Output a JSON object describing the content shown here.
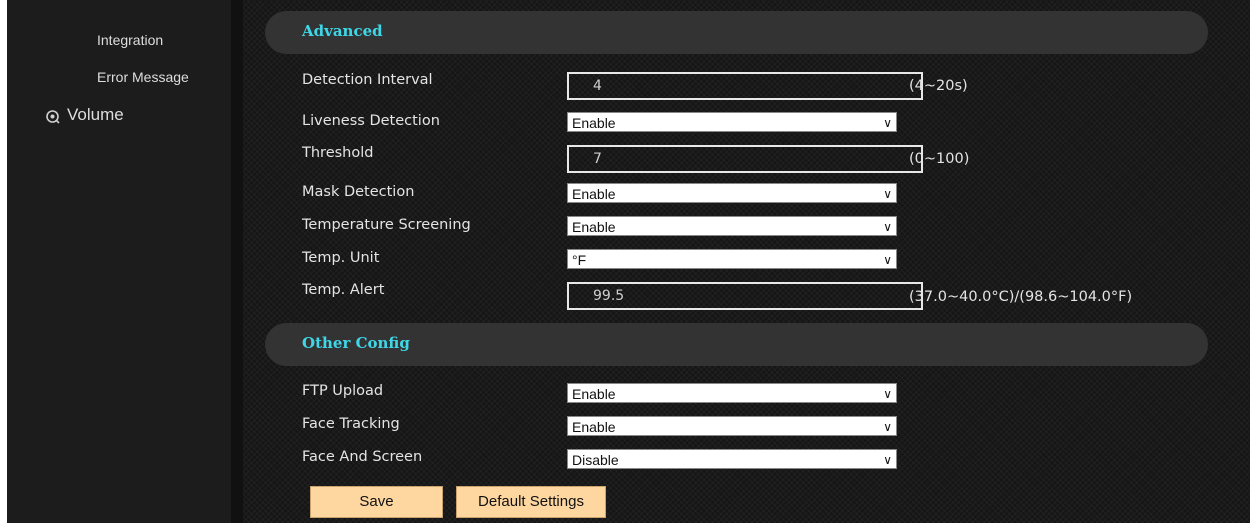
{
  "sidebar": {
    "items": [
      {
        "label": "Integration"
      },
      {
        "label": "Error Message"
      },
      {
        "label": "Volume"
      }
    ]
  },
  "advanced": {
    "title": "Advanced",
    "detection_interval": {
      "label": "Detection Interval",
      "value": "4",
      "hint": "(4~20s)"
    },
    "liveness_detection": {
      "label": "Liveness Detection",
      "value": "Enable"
    },
    "threshold": {
      "label": "Threshold",
      "value": "7",
      "hint": "(0~100)"
    },
    "mask_detection": {
      "label": "Mask Detection",
      "value": "Enable"
    },
    "temperature_screening": {
      "label": "Temperature Screening",
      "value": "Enable"
    },
    "temp_unit": {
      "label": "Temp. Unit",
      "value": "°F"
    },
    "temp_alert": {
      "label": "Temp. Alert",
      "value": "99.5",
      "hint": "(37.0~40.0°C)/(98.6~104.0°F)"
    }
  },
  "other_config": {
    "title": "Other Config",
    "ftp_upload": {
      "label": "FTP Upload",
      "value": "Enable"
    },
    "face_tracking": {
      "label": "Face Tracking",
      "value": "Enable"
    },
    "face_and_screen": {
      "label": "Face And Screen",
      "value": "Disable"
    }
  },
  "buttons": {
    "save": "Save",
    "default_settings": "Default Settings"
  },
  "colors": {
    "section_title": "#3fd7e8",
    "button_bg": "#fdd6a0"
  }
}
